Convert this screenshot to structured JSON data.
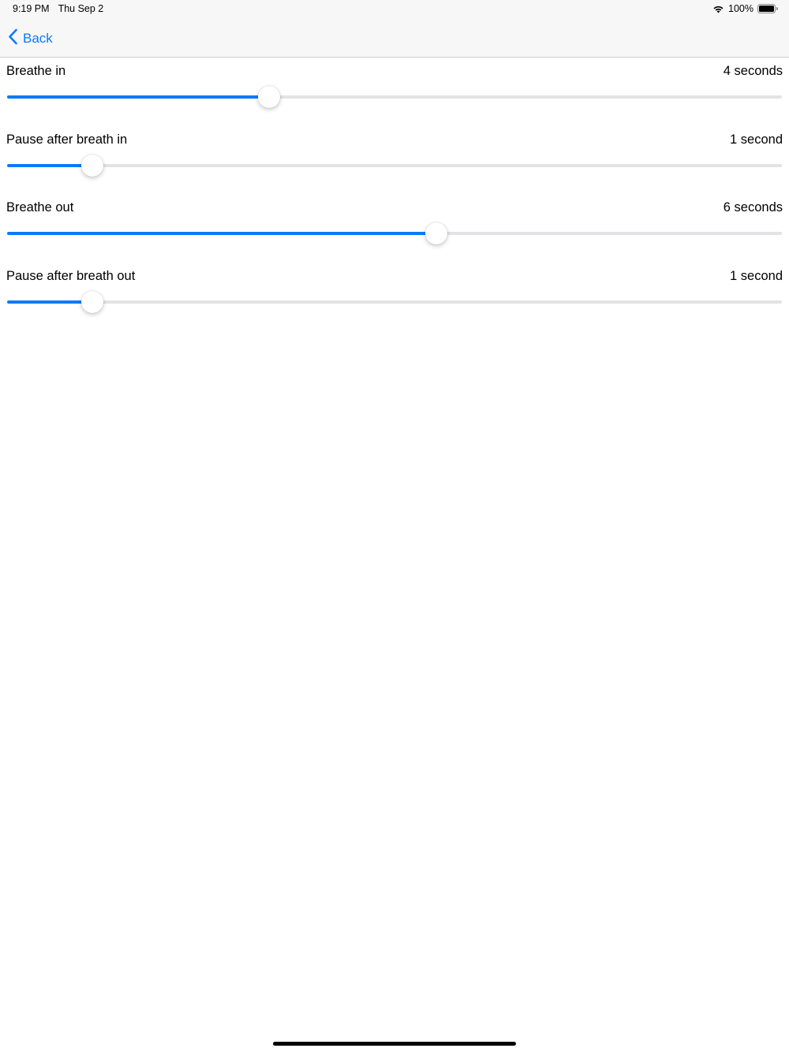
{
  "status_bar": {
    "time": "9:19 PM",
    "date": "Thu Sep 2",
    "battery_percent": "100%",
    "icons": [
      "wifi-icon",
      "battery-icon"
    ]
  },
  "nav": {
    "back_label": "Back",
    "back_icon": "chevron-left-icon"
  },
  "colors": {
    "accent": "#0a7aff",
    "track": "#e3e3e6"
  },
  "settings": [
    {
      "label": "Breathe in",
      "value": "4 seconds",
      "level": 0.338
    },
    {
      "label": "Pause after breath in",
      "value": "1 second",
      "level": 0.11
    },
    {
      "label": "Breathe out",
      "value": "6 seconds",
      "level": 0.554
    },
    {
      "label": "Pause after breath out",
      "value": "1 second",
      "level": 0.11
    }
  ]
}
